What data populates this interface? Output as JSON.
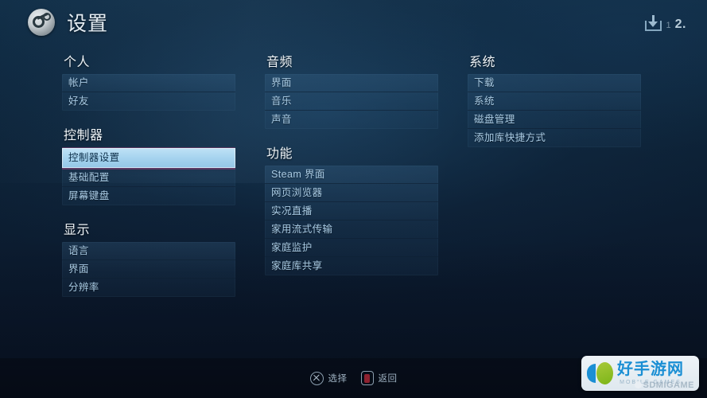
{
  "header": {
    "title": "设置",
    "logo_icon": "steam-logo-icon",
    "download_icon": "download-icon",
    "download_count": "1",
    "secondary_number": "2."
  },
  "columns": [
    {
      "id": "column-left",
      "groups": [
        {
          "title": "个人",
          "items": [
            {
              "label": "帐户",
              "selected": false
            },
            {
              "label": "好友",
              "selected": false
            }
          ]
        },
        {
          "title": "控制器",
          "items": [
            {
              "label": "控制器设置",
              "selected": true
            },
            {
              "label": "基础配置",
              "selected": false
            },
            {
              "label": "屏幕键盘",
              "selected": false
            }
          ]
        },
        {
          "title": "显示",
          "items": [
            {
              "label": "语言",
              "selected": false
            },
            {
              "label": "界面",
              "selected": false
            },
            {
              "label": "分辨率",
              "selected": false
            }
          ]
        }
      ]
    },
    {
      "id": "column-middle",
      "groups": [
        {
          "title": "音频",
          "items": [
            {
              "label": "界面",
              "selected": false
            },
            {
              "label": "音乐",
              "selected": false
            },
            {
              "label": "声音",
              "selected": false
            }
          ]
        },
        {
          "title": "功能",
          "items": [
            {
              "label": "Steam 界面",
              "selected": false
            },
            {
              "label": "网页浏览器",
              "selected": false
            },
            {
              "label": "实况直播",
              "selected": false
            },
            {
              "label": "家用流式传输",
              "selected": false
            },
            {
              "label": "家庭监护",
              "selected": false
            },
            {
              "label": "家庭库共享",
              "selected": false
            }
          ]
        }
      ]
    },
    {
      "id": "column-right",
      "groups": [
        {
          "title": "系统",
          "items": [
            {
              "label": "下载",
              "selected": false
            },
            {
              "label": "系统",
              "selected": false
            },
            {
              "label": "磁盘管理",
              "selected": false
            },
            {
              "label": "添加库快捷方式",
              "selected": false
            }
          ]
        }
      ]
    }
  ],
  "footer": {
    "hints": [
      {
        "icon": "button-x-icon",
        "label": "选择"
      },
      {
        "icon": "button-back-icon",
        "label": "返回"
      }
    ]
  },
  "watermark": {
    "title": "好手游网",
    "subtitle": "MOBILE GAMES",
    "overlay": "SDMIGAME"
  },
  "colors": {
    "selection_fill": "#a7d4ef",
    "selection_border": "#5b3a63",
    "item_text": "#a9cbe4",
    "title_text": "#eef4f8",
    "background_top": "#123049",
    "background_bottom": "#081322",
    "watermark_blue": "#1b8fd4",
    "watermark_green": "#7cb518"
  }
}
